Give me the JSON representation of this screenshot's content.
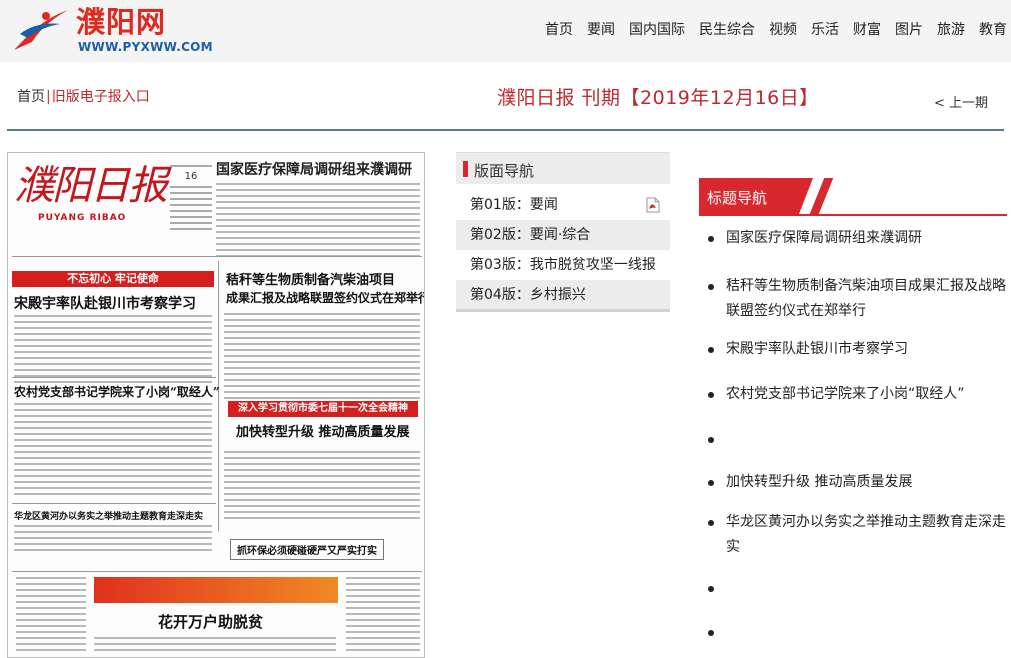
{
  "site": {
    "logo_text": "濮阳网",
    "logo_url": "WWW.PYXWW.COM",
    "brand_color": "#e02a20"
  },
  "nav": {
    "items": [
      "首页",
      "要闻",
      "国内国际",
      "民生综合",
      "视频",
      "乐活",
      "财富",
      "图片",
      "旅游",
      "教育"
    ]
  },
  "breadcrumb": {
    "home": "首页",
    "separator": "|",
    "current": "旧版电子报入口"
  },
  "issue": {
    "title": "濮阳日报 刊期【2019年12月16日】",
    "prev_label": "< 上一期"
  },
  "newspaper": {
    "masthead": "濮阳日报",
    "masthead_en": "PUYANG RIBAO",
    "day": "16",
    "lead_headline": "国家医疗保障局调研组来濮调研",
    "headline_2": "秸秆等生物质制备汽柴油项目",
    "headline_2b": "成果汇报及战略联盟签约仪式在郑举行",
    "band_1": "不忘初心 牢记使命",
    "headline_3": "宋殿宇率队赴银川市考察学习",
    "headline_4": "农村党支部书记学院来了小岗“取经人”",
    "band_2": "深入学习贯彻市委七届十一次全会精神",
    "headline_5": "加快转型升级 推动高质量发展",
    "headline_6": "华龙区黄河办以务实之举推动主题教育走深走实",
    "headline_7": "抓环保必须硬碰硬严又严实打实",
    "headline_8": "花开万户助脱贫"
  },
  "edition_nav": {
    "title": "版面导航",
    "items": [
      {
        "label": "第01版：要闻"
      },
      {
        "label": "第02版：要闻·综合"
      },
      {
        "label": "第03版：我市脱贫攻坚一线报"
      },
      {
        "label": "第04版：乡村振兴"
      }
    ],
    "pdf_icon": "pdf-icon"
  },
  "title_nav": {
    "title": "标题导航",
    "items": [
      "国家医疗保障局调研组来濮调研",
      "秸秆等生物质制备汽柴油项目成果汇报及战略联盟签约仪式在郑举行",
      "宋殿宇率队赴银川市考察学习",
      "农村党支部书记学院来了小岗“取经人”",
      "",
      "加快转型升级 推动高质量发展",
      "华龙区黄河办以务实之举推动主题教育走深走实",
      "",
      ""
    ],
    "accent": "#d9272e"
  }
}
